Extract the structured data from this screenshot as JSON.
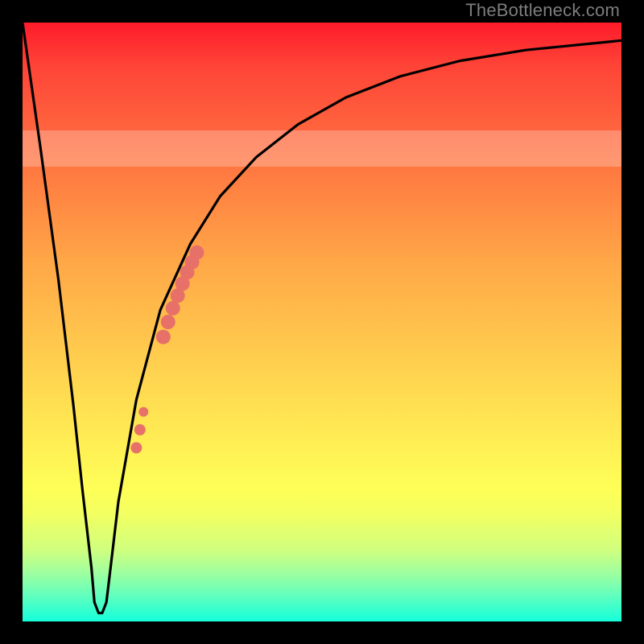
{
  "watermark": "TheBottleneck.com",
  "colors": {
    "frame": "#000000",
    "curve": "#000000",
    "marker": "#e77169",
    "gradient_top": "#fe1b2a",
    "gradient_bottom": "#14ffda"
  },
  "chart_data": {
    "type": "line",
    "title": "",
    "xlabel": "",
    "ylabel": "",
    "xlim": [
      0,
      100
    ],
    "ylim": [
      0,
      100
    ],
    "grid": false,
    "legend": false,
    "series": [
      {
        "name": "bottleneck-curve",
        "x": [
          0,
          3,
          6,
          8.5,
          10,
          11.5,
          12,
          12.7,
          13.3,
          14,
          14.7,
          16,
          19,
          23,
          28,
          33,
          39,
          46,
          54,
          63,
          73,
          84,
          100
        ],
        "values": [
          100,
          79,
          57,
          36,
          22,
          9,
          3.2,
          1.4,
          1.4,
          3.2,
          9,
          20,
          37,
          52,
          63,
          71,
          77.5,
          83,
          87.5,
          91,
          93.6,
          95.4,
          97
        ]
      }
    ],
    "curve_dip": {
      "x_range": [
        12,
        14
      ],
      "y": 1.4
    },
    "markers": {
      "name": "highlighted-points",
      "color": "#e77169",
      "points": [
        {
          "x": 19.0,
          "y": 29.0,
          "r": 7
        },
        {
          "x": 19.6,
          "y": 32.0,
          "r": 7
        },
        {
          "x": 20.2,
          "y": 35.0,
          "r": 6
        },
        {
          "x": 23.5,
          "y": 47.5,
          "r": 9
        },
        {
          "x": 24.3,
          "y": 50.0,
          "r": 9
        },
        {
          "x": 25.1,
          "y": 52.3,
          "r": 9
        },
        {
          "x": 25.9,
          "y": 54.4,
          "r": 9
        },
        {
          "x": 26.7,
          "y": 56.4,
          "r": 9
        },
        {
          "x": 27.5,
          "y": 58.3,
          "r": 9
        },
        {
          "x": 28.3,
          "y": 60.0,
          "r": 9
        },
        {
          "x": 29.1,
          "y": 61.6,
          "r": 9
        }
      ]
    },
    "pale_band": {
      "y_from": 76,
      "y_to": 82
    }
  }
}
